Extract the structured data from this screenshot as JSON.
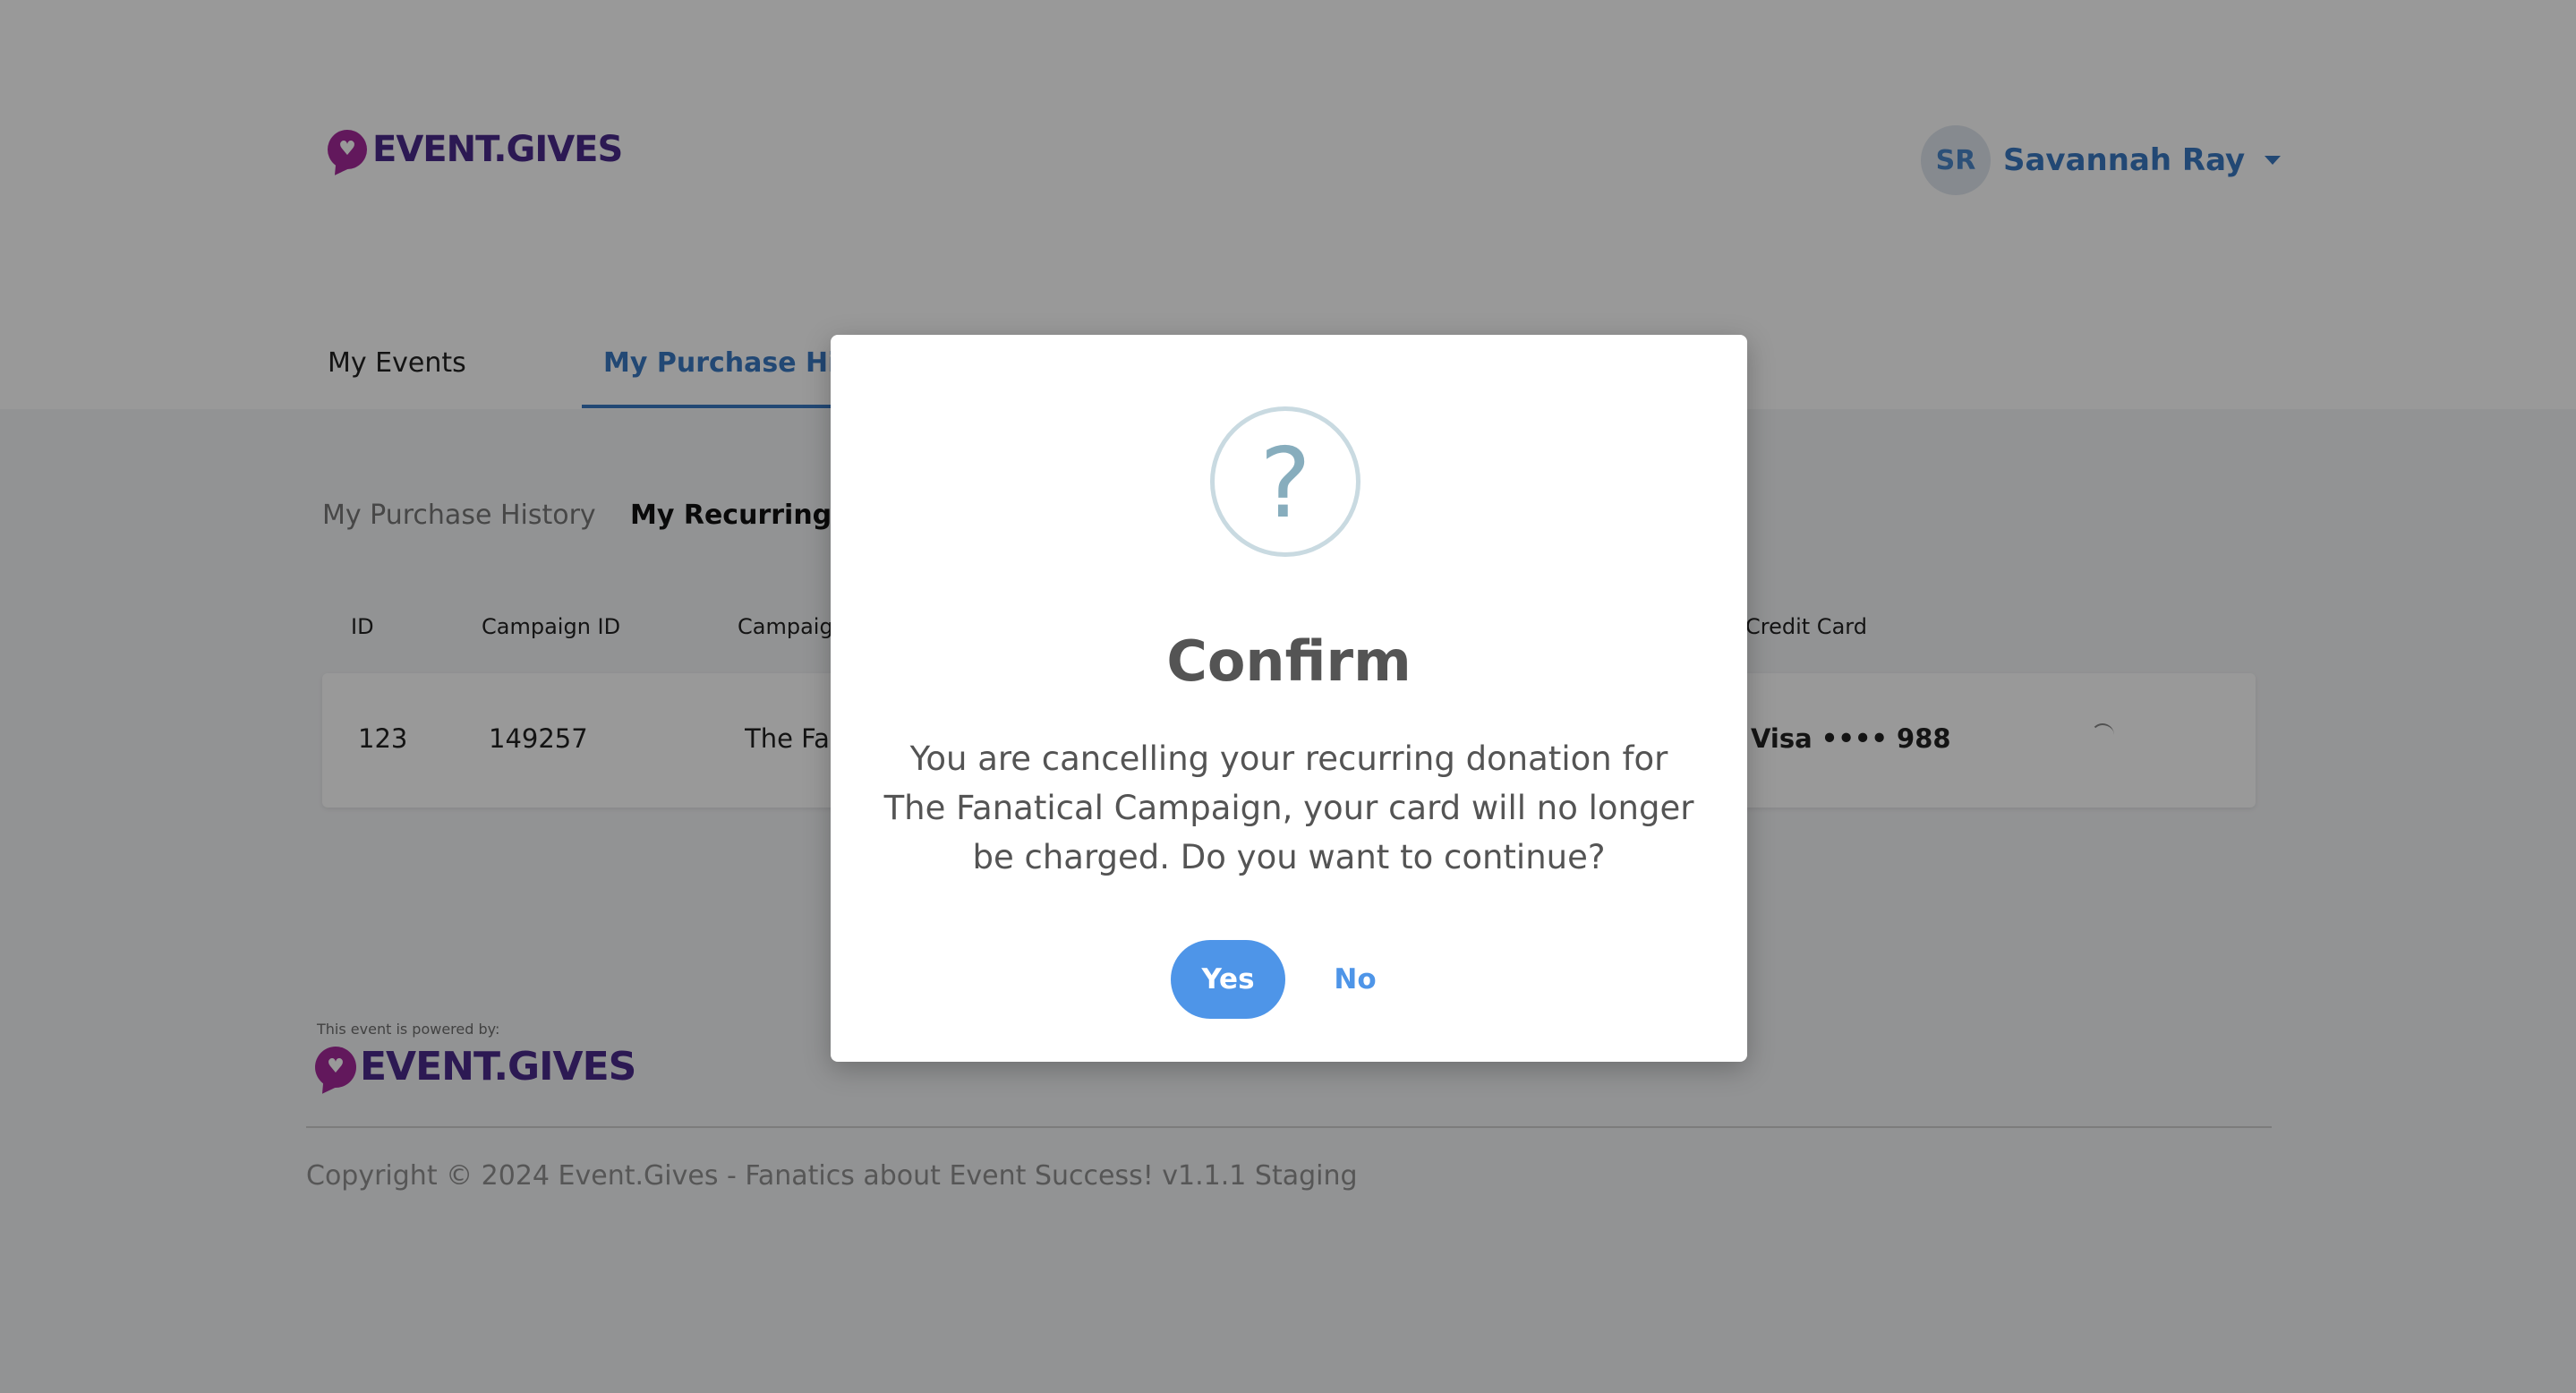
{
  "header": {
    "brand": "EVENT.GIVES",
    "user": {
      "initials": "SR",
      "name": "Savannah Ray"
    }
  },
  "tabs": [
    {
      "label": "My Events"
    },
    {
      "label": "My Purchase History"
    }
  ],
  "subtabs": [
    {
      "label": "My Purchase History"
    },
    {
      "label": "My Recurring Donations"
    }
  ],
  "table": {
    "headers": {
      "id": "ID",
      "campaign_id": "Campaign ID",
      "campaign": "Campaign",
      "credit_card": "Credit Card"
    },
    "rows": [
      {
        "id": "123",
        "campaign_id": "149257",
        "campaign": "The Fanatical Campaign",
        "credit_card": "Visa •••• 988"
      }
    ]
  },
  "footer": {
    "powered_by": "This event is powered by:",
    "brand": "EVENT.GIVES",
    "copyright": "Copyright © 2024 Event.Gives - Fanatics about Event Success! v1.1.1 Staging"
  },
  "modal": {
    "icon": "question-icon",
    "icon_glyph": "?",
    "title": "Confirm",
    "message": "You are cancelling your recurring donation for The Fanatical Campaign, your card will no longer be charged. Do you want to continue?",
    "yes_label": "Yes",
    "no_label": "No"
  },
  "colors": {
    "brand_purple": "#4a2a8a",
    "brand_magenta": "#a3289a",
    "accent_blue": "#3a78c2",
    "button_blue": "#4e95e8"
  }
}
